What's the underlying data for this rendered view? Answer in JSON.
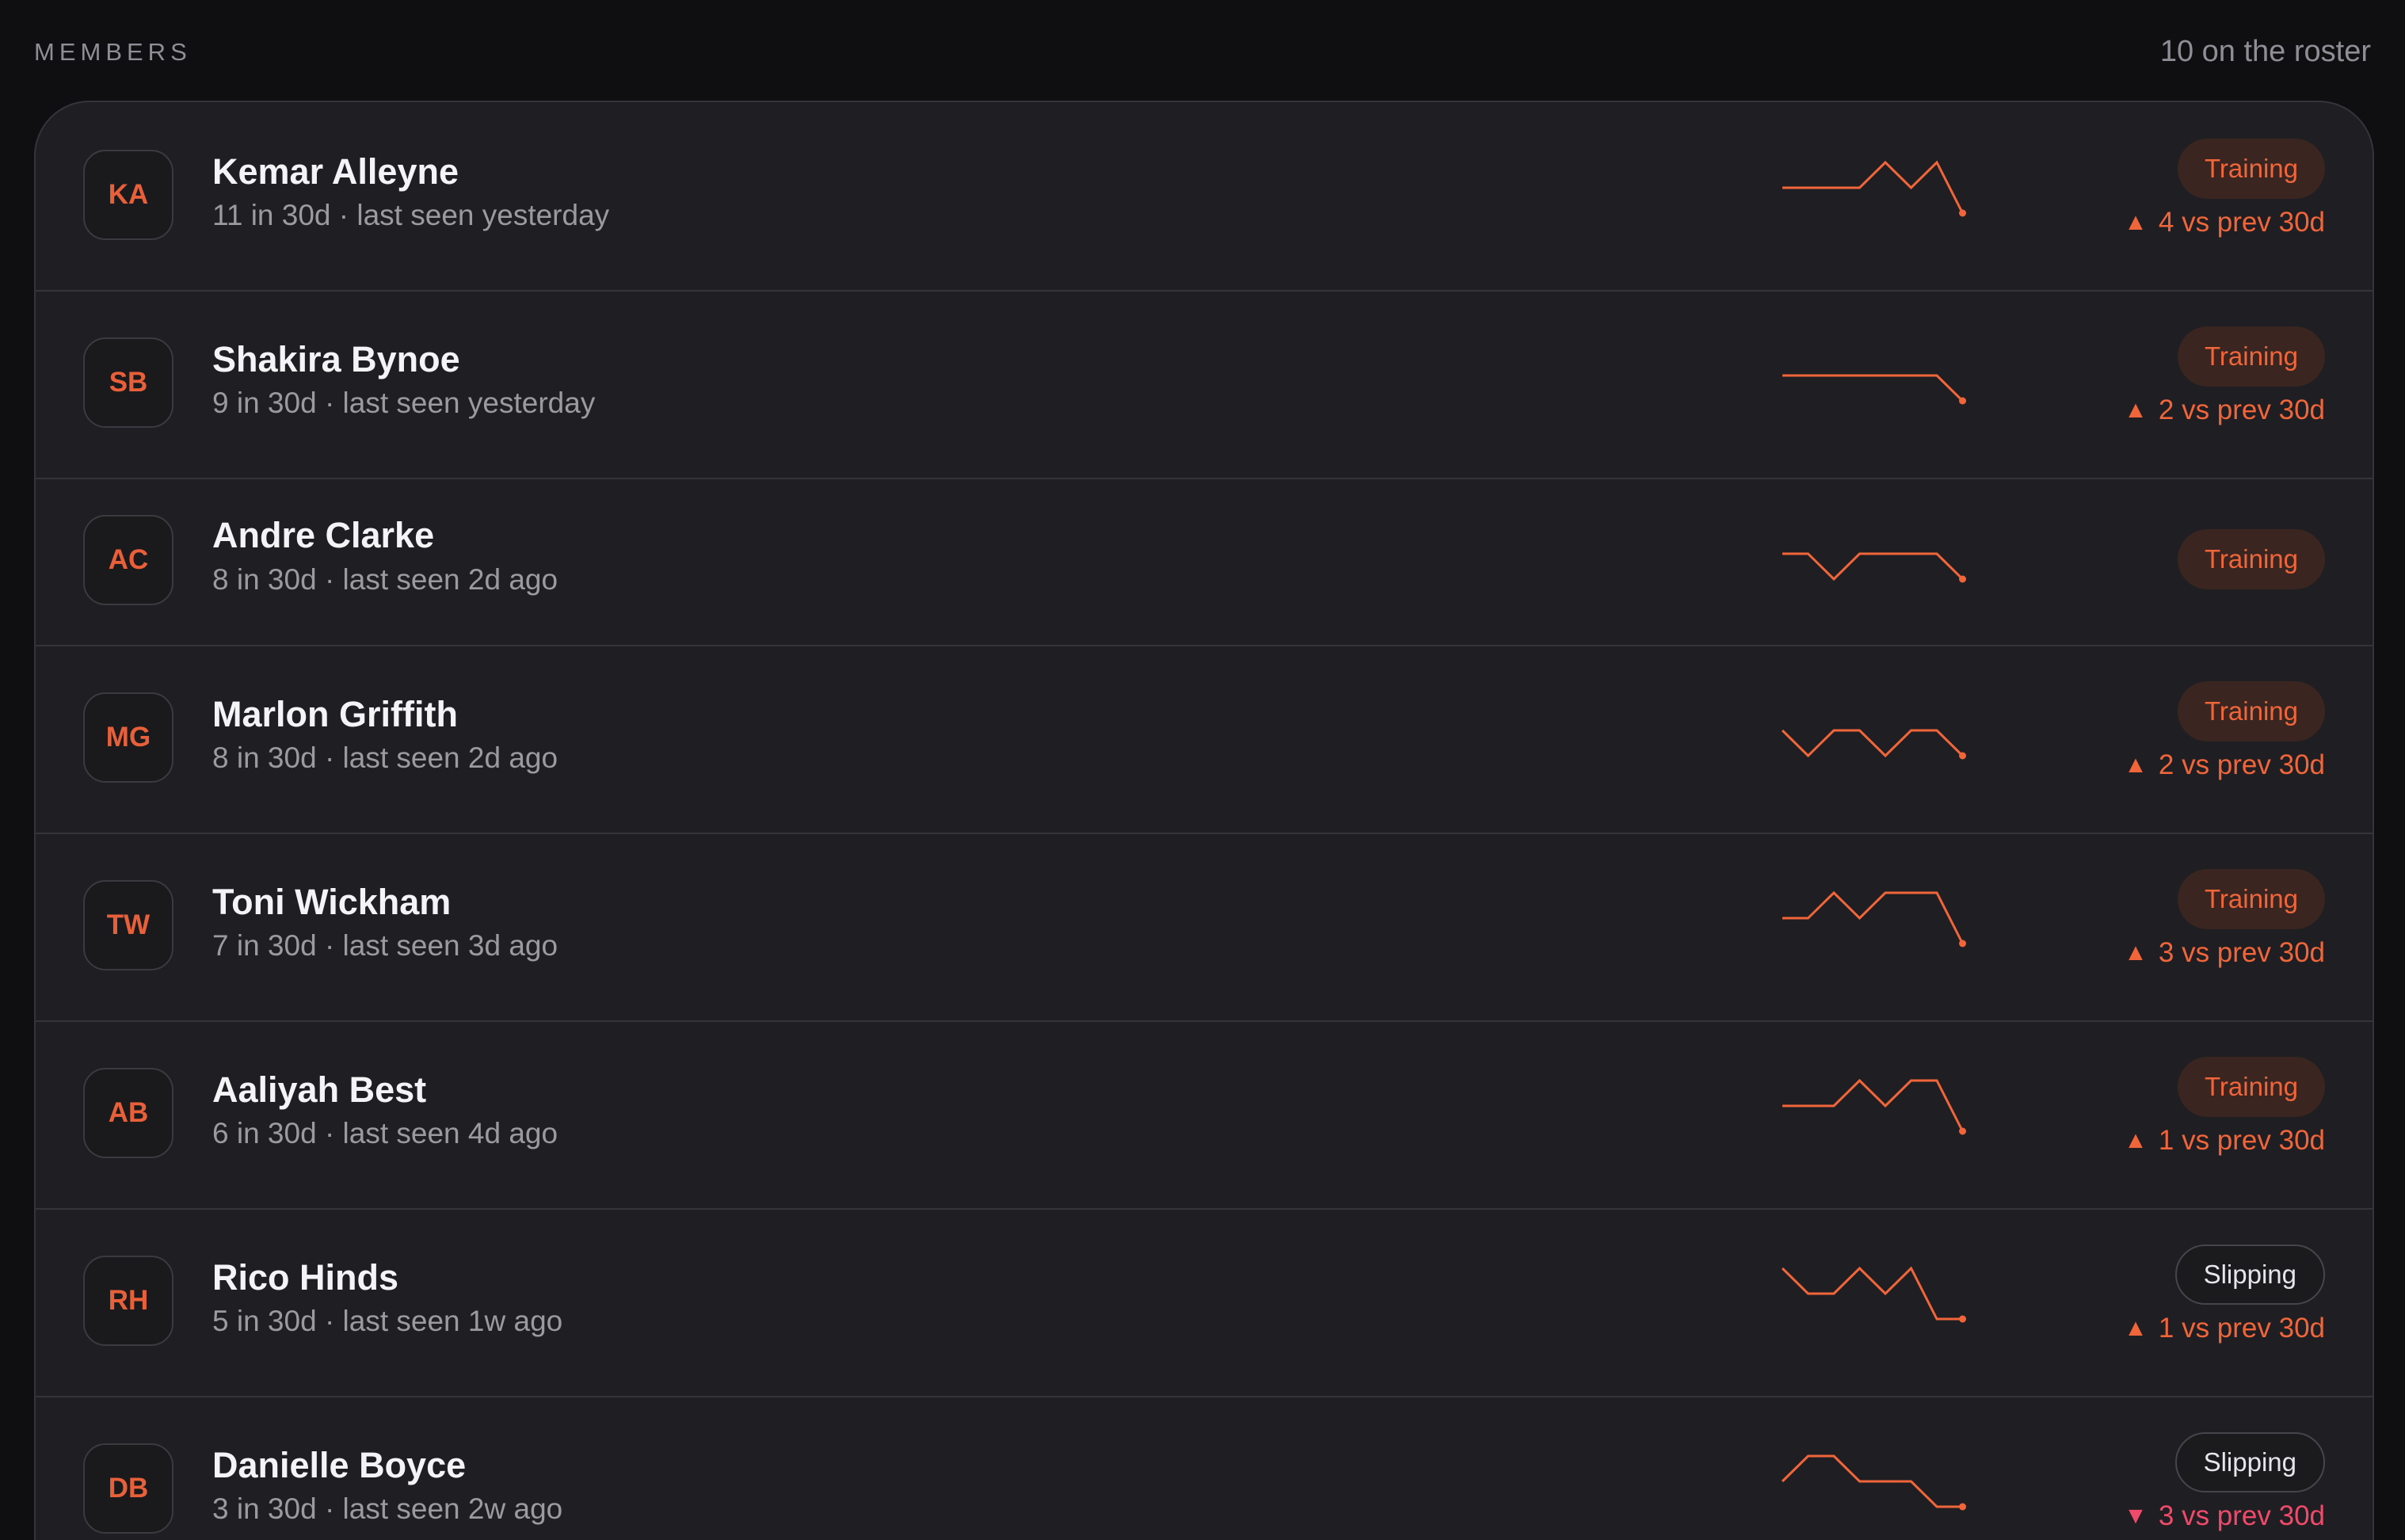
{
  "header": {
    "section_label": "MEMBERS",
    "roster_count": "10 on the roster"
  },
  "colors": {
    "accent": "#f0653a",
    "negative": "#f04a6a",
    "card_bg": "#1f1f23",
    "page_bg": "#0f0f11"
  },
  "members": [
    {
      "initials": "KA",
      "name": "Kemar Alleyne",
      "meta": "11 in 30d · last seen yesterday",
      "status": "Training",
      "status_kind": "training",
      "delta_icon": "▲",
      "delta_text": "4 vs prev 30d",
      "delta_dir": "up",
      "trend": [
        1,
        1,
        1,
        1,
        2,
        1,
        2,
        0
      ]
    },
    {
      "initials": "SB",
      "name": "Shakira Bynoe",
      "meta": "9 in 30d · last seen yesterday",
      "status": "Training",
      "status_kind": "training",
      "delta_icon": "▲",
      "delta_text": "2 vs prev 30d",
      "delta_dir": "up",
      "trend": [
        1,
        1,
        1,
        1,
        1,
        1,
        1,
        0
      ]
    },
    {
      "initials": "AC",
      "name": "Andre Clarke",
      "meta": "8 in 30d · last seen 2d ago",
      "status": "Training",
      "status_kind": "training",
      "delta_icon": "",
      "delta_text": "",
      "delta_dir": "none",
      "trend": [
        1,
        1,
        0,
        1,
        1,
        1,
        1,
        0
      ]
    },
    {
      "initials": "MG",
      "name": "Marlon Griffith",
      "meta": "8 in 30d · last seen 2d ago",
      "status": "Training",
      "status_kind": "training",
      "delta_icon": "▲",
      "delta_text": "2 vs prev 30d",
      "delta_dir": "up",
      "trend": [
        1,
        0,
        1,
        1,
        0,
        1,
        1,
        0
      ]
    },
    {
      "initials": "TW",
      "name": "Toni Wickham",
      "meta": "7 in 30d · last seen 3d ago",
      "status": "Training",
      "status_kind": "training",
      "delta_icon": "▲",
      "delta_text": "3 vs prev 30d",
      "delta_dir": "up",
      "trend": [
        1,
        1,
        2,
        1,
        2,
        2,
        2,
        0
      ]
    },
    {
      "initials": "AB",
      "name": "Aaliyah Best",
      "meta": "6 in 30d · last seen 4d ago",
      "status": "Training",
      "status_kind": "training",
      "delta_icon": "▲",
      "delta_text": "1 vs prev 30d",
      "delta_dir": "up",
      "trend": [
        1,
        1,
        1,
        2,
        1,
        2,
        2,
        0
      ]
    },
    {
      "initials": "RH",
      "name": "Rico Hinds",
      "meta": "5 in 30d · last seen 1w ago",
      "status": "Slipping",
      "status_kind": "slipping",
      "delta_icon": "▲",
      "delta_text": "1 vs prev 30d",
      "delta_dir": "up",
      "trend": [
        2,
        1,
        1,
        2,
        1,
        2,
        0,
        0
      ]
    },
    {
      "initials": "DB",
      "name": "Danielle Boyce",
      "meta": "3 in 30d · last seen 2w ago",
      "status": "Slipping",
      "status_kind": "slipping",
      "delta_icon": "▼",
      "delta_text": "3 vs prev 30d",
      "delta_dir": "down",
      "trend": [
        1,
        2,
        2,
        1,
        1,
        1,
        0,
        0
      ]
    }
  ]
}
